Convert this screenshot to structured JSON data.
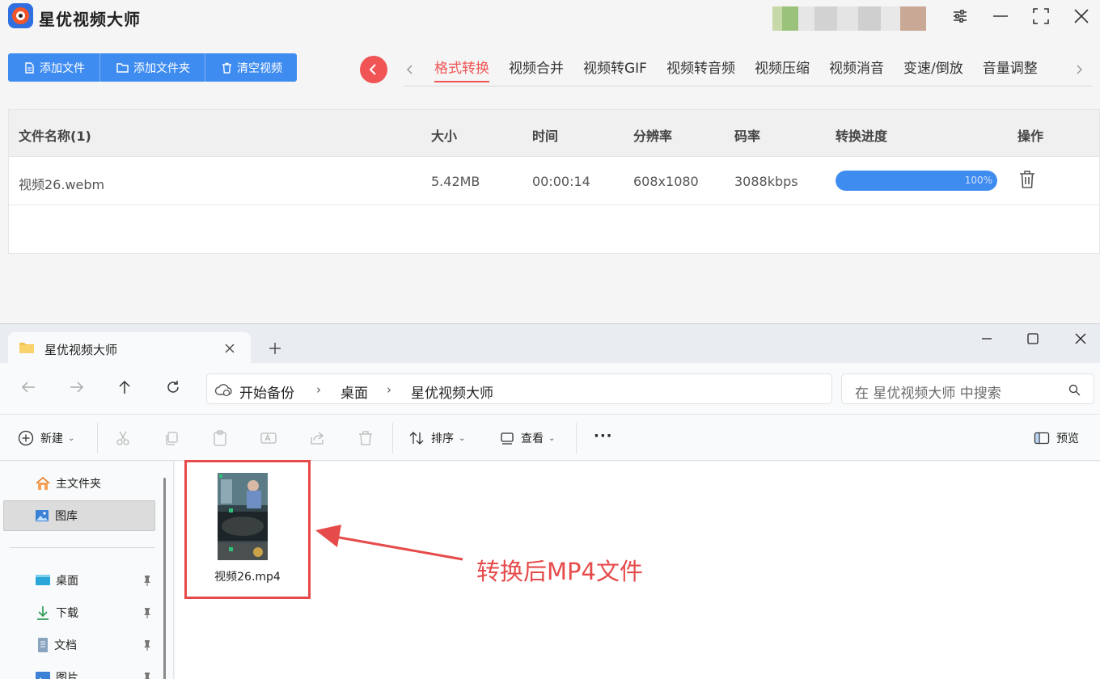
{
  "app": {
    "title": "星优视频大师",
    "toolbar": {
      "add_file": "添加文件",
      "add_folder": "添加文件夹",
      "clear": "清空视频"
    },
    "tabs": [
      {
        "label": "格式转换",
        "active": true
      },
      {
        "label": "视频合并"
      },
      {
        "label": "视频转GIF"
      },
      {
        "label": "视频转音频"
      },
      {
        "label": "视频压缩"
      },
      {
        "label": "视频消音"
      },
      {
        "label": "变速/倒放"
      },
      {
        "label": "音量调整"
      }
    ],
    "table": {
      "headers": {
        "name": "文件名称(1)",
        "size": "大小",
        "time": "时间",
        "resolution": "分辨率",
        "bitrate": "码率",
        "progress": "转换进度",
        "action": "操作"
      },
      "rows": [
        {
          "name": "视频26.webm",
          "size": "5.42MB",
          "time": "00:00:14",
          "resolution": "608x1080",
          "bitrate": "3088kbps",
          "progress_text": "100%",
          "progress_value": 1.0
        }
      ]
    },
    "colors": {
      "primary": "#3f8cf0",
      "accent": "#f05454"
    }
  },
  "explorer": {
    "tab_title": "星优视频大师",
    "breadcrumb": [
      "开始备份",
      "桌面",
      "星优视频大师"
    ],
    "search_placeholder": "在 星优视频大师 中搜索",
    "commands": {
      "new": "新建",
      "sort": "排序",
      "view": "查看",
      "more": "···",
      "preview": "预览"
    },
    "sidebar": [
      {
        "label": "主文件夹",
        "icon": "home-icon"
      },
      {
        "label": "图库",
        "icon": "gallery-icon",
        "selected": true
      },
      {
        "label": "桌面",
        "icon": "desktop-icon",
        "pinned": true
      },
      {
        "label": "下载",
        "icon": "download-icon",
        "pinned": true
      },
      {
        "label": "文档",
        "icon": "document-icon",
        "pinned": true
      },
      {
        "label": "图片",
        "icon": "picture-icon",
        "pinned": true
      }
    ],
    "files": [
      {
        "name": "视频26.mp4"
      }
    ],
    "annotation": "转换后MP4文件"
  }
}
